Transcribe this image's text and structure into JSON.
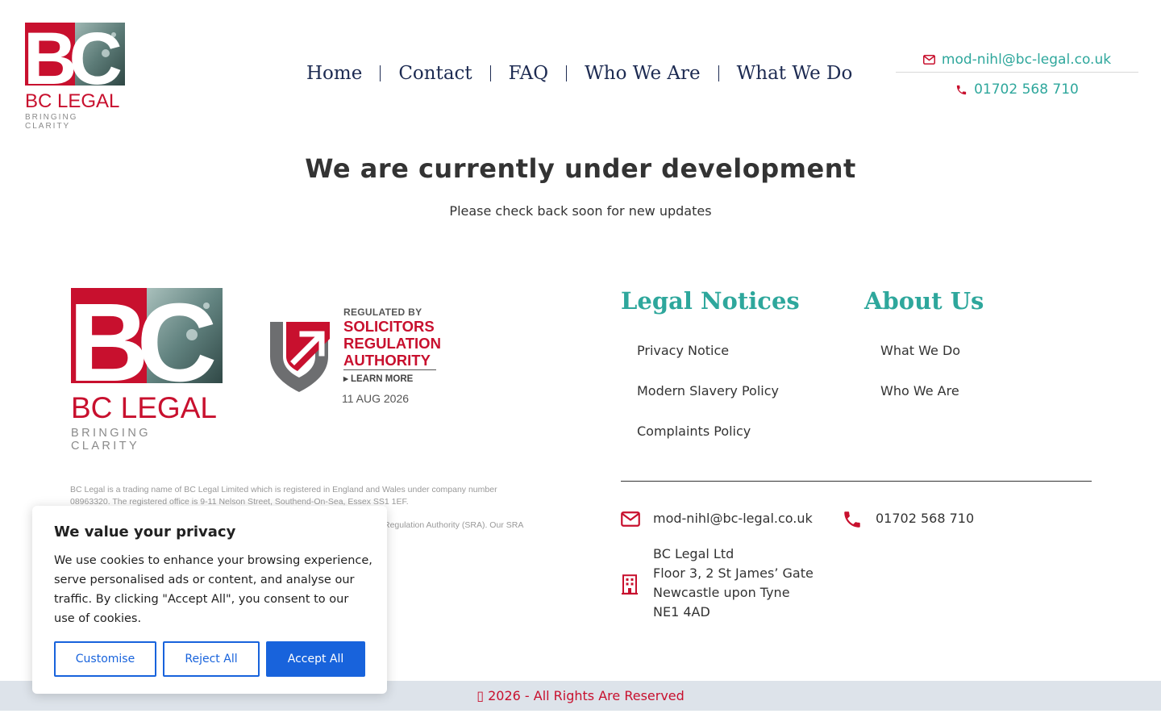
{
  "header": {
    "logo": {
      "letters": "BC",
      "name": "BC LEGAL",
      "tagline": "BRINGING CLARITY"
    },
    "nav": [
      {
        "label": "Home"
      },
      {
        "label": "Contact"
      },
      {
        "label": "FAQ"
      },
      {
        "label": "Who We Are"
      },
      {
        "label": "What We Do"
      }
    ],
    "contact": {
      "email": "mod-nihl@bc-legal.co.uk",
      "phone": "01702 568 710",
      "email_icon": "envelope-icon",
      "phone_icon": "phone-icon"
    }
  },
  "main": {
    "title": "We are currently under development",
    "subtitle": "Please check back soon for new updates"
  },
  "footer": {
    "logo": {
      "letters": "BC",
      "name": "BC LEGAL",
      "tagline": "BRINGING CLARITY"
    },
    "sra": {
      "regulated_by": "REGULATED BY",
      "name_lines": [
        "SOLICITORS",
        "REGULATION",
        "AUTHORITY"
      ],
      "learn_more": "LEARN MORE",
      "date": "11 AUG 2026"
    },
    "legal_text": {
      "line1": "BC Legal is a trading name of BC Legal Limited which is registered in England and Wales under company number",
      "line2": "08963320. The registered office is 9-11 Nelson Street, Southend-On-Sea, Essex SS1 1EF.",
      "line3": "Regulation Authority (SRA).  Our SRA"
    },
    "legal_notices": {
      "title": "Legal Notices",
      "links": [
        "Privacy Notice",
        "Modern Slavery Policy",
        "Complaints Policy"
      ]
    },
    "about_us": {
      "title": "About Us",
      "links": [
        "What We Do",
        "Who We Are"
      ]
    },
    "contact": {
      "email": "mod-nihl@bc-legal.co.uk",
      "phone": "01702 568 710",
      "address": [
        "BC Legal Ltd",
        "Floor 3, 2 St James’ Gate",
        "Newcastle upon Tyne",
        "NE1 4AD"
      ]
    },
    "copyright": " 2026 - All Rights Are Reserved"
  },
  "cookie_banner": {
    "title": "We value your privacy",
    "text": "We use cookies to enhance your browsing experience, serve personalised ads or content, and analyse our traffic. By clicking \"Accept All\", you consent to our use of cookies.",
    "buttons": {
      "customise": "Customise",
      "reject": "Reject All",
      "accept": "Accept All"
    }
  },
  "colors": {
    "brand_red": "#c8102e",
    "teal": "#2ea79c",
    "navy": "#1d2b52",
    "cookie_blue": "#1863dc"
  }
}
